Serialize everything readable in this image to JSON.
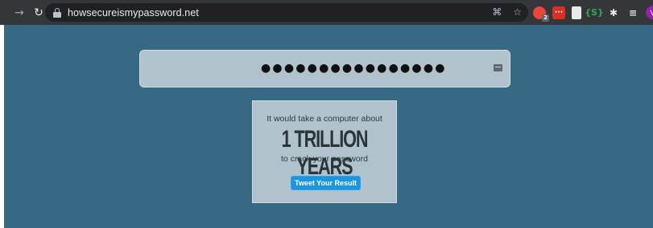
{
  "browser": {
    "url": "howsecureismypassword.net",
    "icons": [
      "arrow-forward-icon",
      "reload-icon",
      "lock-icon",
      "qr-code-icon",
      "star-icon",
      "extension-icon",
      "media-queue-icon"
    ],
    "extension_badge": "2",
    "extension_green": "{S}",
    "profile_initial": "V"
  },
  "main": {
    "password_mask": "●●●●●●●●●●●●●●●●",
    "result_prefix": "It would take a computer about",
    "result_time": "1 TRILLION YEARS",
    "result_suffix": "to crack your password",
    "tweet_button": "Tweet Your Result"
  },
  "colors": {
    "page_background": "#376985",
    "panel_background": "#b0c3cd",
    "tweet_button": "#1b95e0"
  }
}
